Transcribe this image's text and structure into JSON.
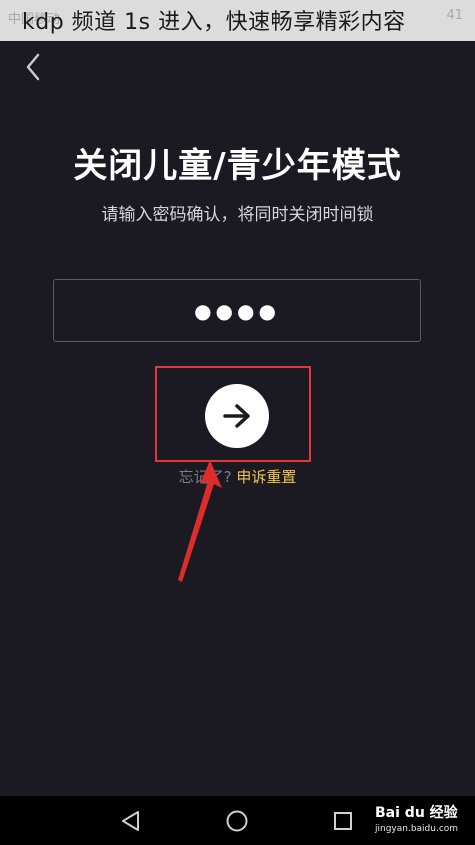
{
  "banner": {
    "title": "kdp 频道 1s 进入，快速畅享精彩内容"
  },
  "status_bar": {
    "carrier": "中国移动",
    "time": "41"
  },
  "page": {
    "title": "关闭儿童/青少年模式",
    "subtitle": "请输入密码确认，将同时关闭时间锁"
  },
  "password": {
    "masked_value": "●●●●"
  },
  "forgot": {
    "label": "忘记了?",
    "reset_link": "申诉重置"
  },
  "watermark": {
    "brand": "Bai du 经验",
    "url": "jingyan.baidu.com"
  },
  "colors": {
    "background": "#1b1a23",
    "accent": "#f0c54b",
    "highlight": "#e13a3a"
  }
}
